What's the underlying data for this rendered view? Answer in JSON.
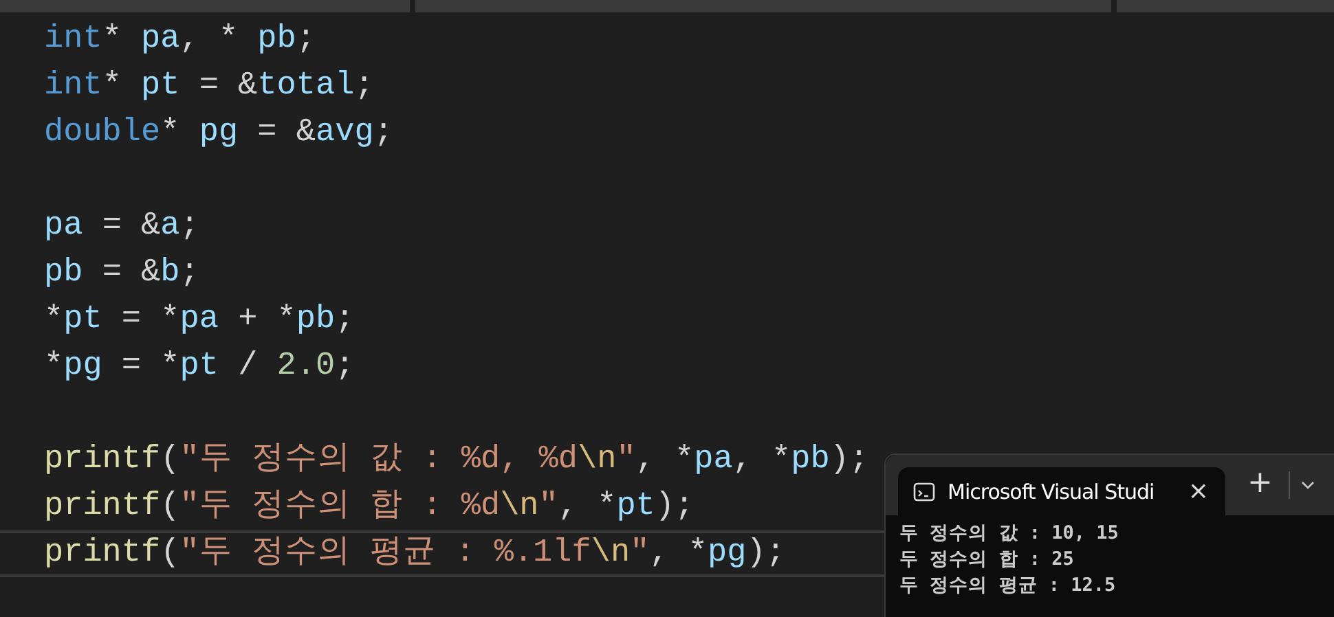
{
  "editor": {
    "lines": [
      {
        "kind": "code",
        "current": false,
        "tokens": [
          {
            "text": "int",
            "kind": "keyword"
          },
          {
            "text": "* ",
            "kind": "op"
          },
          {
            "text": "pa",
            "kind": "var"
          },
          {
            "text": ", * ",
            "kind": "op"
          },
          {
            "text": "pb",
            "kind": "var"
          },
          {
            "text": ";",
            "kind": "op"
          }
        ]
      },
      {
        "kind": "code",
        "current": false,
        "tokens": [
          {
            "text": "int",
            "kind": "keyword"
          },
          {
            "text": "* ",
            "kind": "op"
          },
          {
            "text": "pt",
            "kind": "var"
          },
          {
            "text": " = &",
            "kind": "op"
          },
          {
            "text": "total",
            "kind": "var"
          },
          {
            "text": ";",
            "kind": "op"
          }
        ]
      },
      {
        "kind": "code",
        "current": false,
        "tokens": [
          {
            "text": "double",
            "kind": "keyword"
          },
          {
            "text": "* ",
            "kind": "op"
          },
          {
            "text": "pg",
            "kind": "var"
          },
          {
            "text": " = &",
            "kind": "op"
          },
          {
            "text": "avg",
            "kind": "var"
          },
          {
            "text": ";",
            "kind": "op"
          }
        ]
      },
      {
        "kind": "blank"
      },
      {
        "kind": "code",
        "current": false,
        "tokens": [
          {
            "text": "pa",
            "kind": "var"
          },
          {
            "text": " = &",
            "kind": "op"
          },
          {
            "text": "a",
            "kind": "var"
          },
          {
            "text": ";",
            "kind": "op"
          }
        ]
      },
      {
        "kind": "code",
        "current": false,
        "tokens": [
          {
            "text": "pb",
            "kind": "var"
          },
          {
            "text": " = &",
            "kind": "op"
          },
          {
            "text": "b",
            "kind": "var"
          },
          {
            "text": ";",
            "kind": "op"
          }
        ]
      },
      {
        "kind": "code",
        "current": false,
        "tokens": [
          {
            "text": "*",
            "kind": "op"
          },
          {
            "text": "pt",
            "kind": "var"
          },
          {
            "text": " = *",
            "kind": "op"
          },
          {
            "text": "pa",
            "kind": "var"
          },
          {
            "text": " + *",
            "kind": "op"
          },
          {
            "text": "pb",
            "kind": "var"
          },
          {
            "text": ";",
            "kind": "op"
          }
        ]
      },
      {
        "kind": "code",
        "current": false,
        "tokens": [
          {
            "text": "*",
            "kind": "op"
          },
          {
            "text": "pg",
            "kind": "var"
          },
          {
            "text": " = *",
            "kind": "op"
          },
          {
            "text": "pt",
            "kind": "var"
          },
          {
            "text": " / ",
            "kind": "op"
          },
          {
            "text": "2.0",
            "kind": "number"
          },
          {
            "text": ";",
            "kind": "op"
          }
        ]
      },
      {
        "kind": "blank"
      },
      {
        "kind": "code",
        "current": false,
        "tokens": [
          {
            "text": "printf",
            "kind": "func"
          },
          {
            "text": "(",
            "kind": "op"
          },
          {
            "text": "\"두 정수의 값 : %d, %d",
            "kind": "string"
          },
          {
            "text": "\\n",
            "kind": "escape"
          },
          {
            "text": "\"",
            "kind": "string"
          },
          {
            "text": ", *",
            "kind": "op"
          },
          {
            "text": "pa",
            "kind": "var"
          },
          {
            "text": ", *",
            "kind": "op"
          },
          {
            "text": "pb",
            "kind": "var"
          },
          {
            "text": ");",
            "kind": "op"
          }
        ]
      },
      {
        "kind": "code",
        "current": false,
        "tokens": [
          {
            "text": "printf",
            "kind": "func"
          },
          {
            "text": "(",
            "kind": "op"
          },
          {
            "text": "\"두 정수의 합 : %d",
            "kind": "string"
          },
          {
            "text": "\\n",
            "kind": "escape"
          },
          {
            "text": "\"",
            "kind": "string"
          },
          {
            "text": ", *",
            "kind": "op"
          },
          {
            "text": "pt",
            "kind": "var"
          },
          {
            "text": ");",
            "kind": "op"
          }
        ]
      },
      {
        "kind": "code",
        "current": true,
        "tokens": [
          {
            "text": "printf",
            "kind": "func"
          },
          {
            "text": "(",
            "kind": "op"
          },
          {
            "text": "\"두 정수의 평균 : %.1lf",
            "kind": "string"
          },
          {
            "text": "\\n",
            "kind": "escape"
          },
          {
            "text": "\"",
            "kind": "string"
          },
          {
            "text": ", *",
            "kind": "op"
          },
          {
            "text": "pg",
            "kind": "var"
          },
          {
            "text": ");",
            "kind": "op"
          }
        ]
      }
    ]
  },
  "terminal": {
    "tab_title": "Microsoft Visual Studi",
    "close": "×",
    "new_tab": "+",
    "output": [
      "두 정수의 값 : 10, 15",
      "두 정수의 합 : 25",
      "두 정수의 평균 : 12.5"
    ]
  }
}
